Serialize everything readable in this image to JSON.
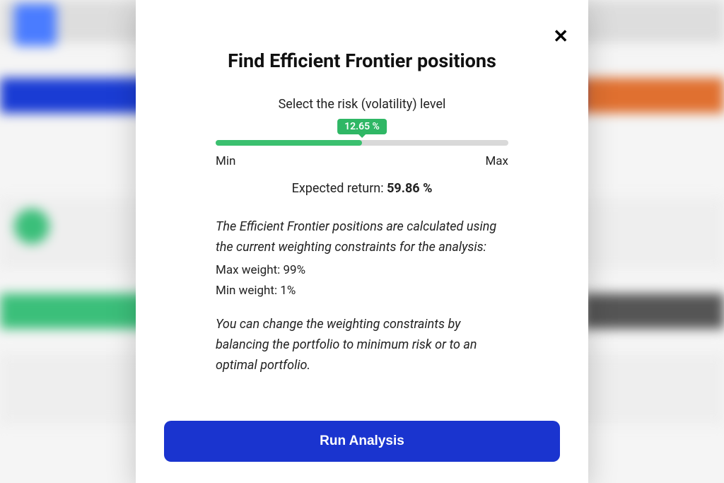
{
  "modal": {
    "title": "Find Efficient Frontier positions",
    "subtitle": "Select the risk (volatility) level",
    "close_label": "✕",
    "slider": {
      "value_pct": "12.65 %",
      "fill_percent": 50,
      "min_label": "Min",
      "max_label": "Max"
    },
    "expected_return_label": "Expected return: ",
    "expected_return_value": "59.86 %",
    "info": {
      "intro_italic": "The Efficient Frontier positions are calculated using the current weighting constraints for the analysis:",
      "max_weight": "Max weight: 99%",
      "min_weight": "Min weight: 1%",
      "change_italic": "You can change the weighting constraints by balancing the portfolio to minimum risk or to an optimal portfolio."
    },
    "run_button": "Run Analysis"
  },
  "colors": {
    "primary_button": "#1a34cf",
    "slider_green": "#3bc06f",
    "tooltip_green": "#2fb765"
  }
}
